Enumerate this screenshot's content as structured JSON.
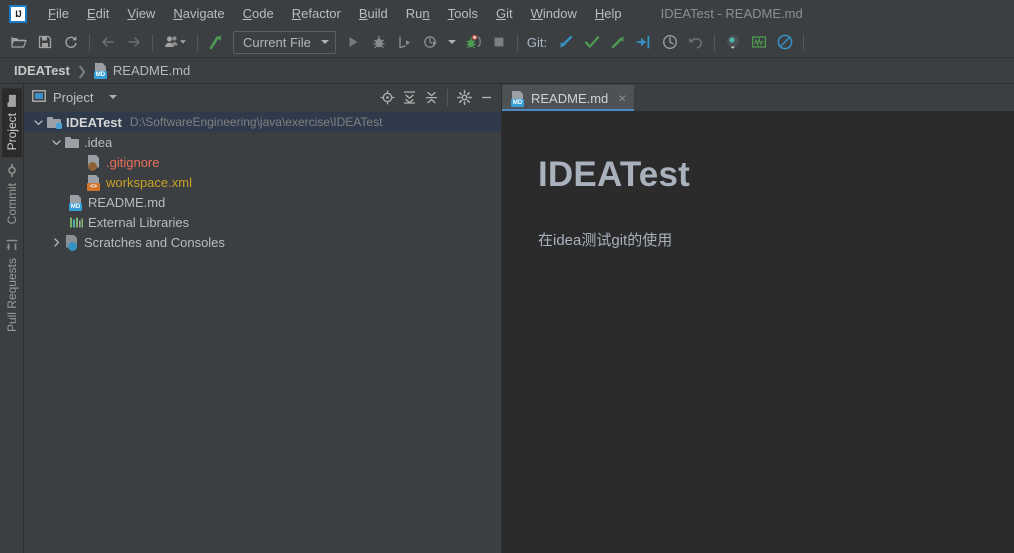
{
  "window": {
    "title": "IDEATest - README.md"
  },
  "menubar": {
    "items": [
      {
        "label": "File",
        "mnemonic": "F"
      },
      {
        "label": "Edit",
        "mnemonic": "E"
      },
      {
        "label": "View",
        "mnemonic": "V"
      },
      {
        "label": "Navigate",
        "mnemonic": "N"
      },
      {
        "label": "Code",
        "mnemonic": "C"
      },
      {
        "label": "Refactor",
        "mnemonic": "R"
      },
      {
        "label": "Build",
        "mnemonic": "B"
      },
      {
        "label": "Run",
        "mnemonic": "n"
      },
      {
        "label": "Tools",
        "mnemonic": "T"
      },
      {
        "label": "Git",
        "mnemonic": "G"
      },
      {
        "label": "Window",
        "mnemonic": "W"
      },
      {
        "label": "Help",
        "mnemonic": "H"
      }
    ]
  },
  "toolbar": {
    "icons": [
      "open-folder-icon",
      "save-all-icon",
      "sync-refresh-icon",
      "navigate-back-icon",
      "navigate-forward-icon",
      "user-profile-icon",
      "update-project-icon"
    ],
    "run_config": {
      "label": "Current File"
    },
    "run_icons": [
      "run-icon",
      "debug-icon",
      "profile-icon",
      "run-coverage-icon",
      "attach-debugger-icon",
      "stop-icon"
    ],
    "git_label": "Git:",
    "git_icons": [
      "git-update-icon",
      "git-commit-icon",
      "git-push-icon",
      "git-branch-merge-icon",
      "git-history-icon",
      "git-rollback-icon"
    ],
    "right_icons": [
      "search-everywhere-icon",
      "profiler-monitor-icon",
      "no-entry-icon"
    ]
  },
  "breadcrumb": {
    "separator": "❯",
    "items": [
      {
        "label": "IDEATest",
        "icon": "project-icon",
        "bold": true
      },
      {
        "label": "README.md",
        "icon": "markdown-file-icon",
        "badge": "MD",
        "bold": false
      }
    ]
  },
  "stripe": {
    "tabs": [
      {
        "label": "Project",
        "icon": "project-folder-icon",
        "active": true
      },
      {
        "label": "Commit",
        "icon": "commit-icon",
        "active": false
      },
      {
        "label": "Pull Requests",
        "icon": "pull-request-icon",
        "active": false
      }
    ]
  },
  "project_panel": {
    "title": "Project",
    "title_icon": "project-view-icon",
    "tools": [
      "locate-file-icon",
      "expand-all-icon",
      "collapse-all-icon",
      "settings-gear-icon",
      "hide-panel-icon"
    ],
    "tree": [
      {
        "label": "IDEATest",
        "path": "D:\\SoftwareEngineering\\java\\exercise\\IDEATest",
        "indent": 0,
        "twisty": "expanded",
        "icon": "project-root-icon",
        "selected": true,
        "bold": true,
        "color": "#d6d6d6"
      },
      {
        "label": ".idea",
        "path": "",
        "indent": 1,
        "twisty": "expanded",
        "icon": "folder-icon",
        "selected": false,
        "bold": false,
        "color": "#bbbbbb"
      },
      {
        "label": ".gitignore",
        "path": "",
        "indent": 2,
        "twisty": "none",
        "icon": "ignored-file-icon",
        "badge": "",
        "selected": false,
        "bold": false,
        "color": "#e8705a"
      },
      {
        "label": "workspace.xml",
        "path": "",
        "indent": 2,
        "twisty": "none",
        "icon": "xml-file-icon",
        "badge": "<>",
        "selected": false,
        "bold": false,
        "color": "#c9a227"
      },
      {
        "label": "README.md",
        "path": "",
        "indent": 1,
        "twisty": "none",
        "icon": "markdown-file-icon",
        "badge": "MD",
        "selected": false,
        "bold": false,
        "color": "#bbbbbb"
      },
      {
        "label": "External Libraries",
        "path": "",
        "indent": 1,
        "twisty": "none",
        "icon": "libraries-icon",
        "selected": false,
        "bold": false,
        "color": "#bbbbbb"
      },
      {
        "label": "Scratches and Consoles",
        "path": "",
        "indent": 1,
        "twisty": "collapsed",
        "icon": "scratches-icon",
        "selected": false,
        "bold": false,
        "color": "#bbbbbb"
      }
    ]
  },
  "editor": {
    "tabs": [
      {
        "label": "README.md",
        "icon": "markdown-file-icon",
        "badge": "MD",
        "active": true,
        "close": "×"
      }
    ],
    "preview": {
      "heading": "IDEATest",
      "paragraph": "在idea测试git的使用"
    }
  },
  "colors": {
    "panel_bg": "#3c3f41",
    "editor_bg": "#2b2b2b",
    "selection_bg": "#2f3a4b",
    "accent_blue": "#4a88c7",
    "green": "#59a869",
    "ignored_red": "#e8705a",
    "xml_yellow": "#c9a227",
    "md_badge": "#389fd6",
    "text": "#bbbbbb"
  }
}
